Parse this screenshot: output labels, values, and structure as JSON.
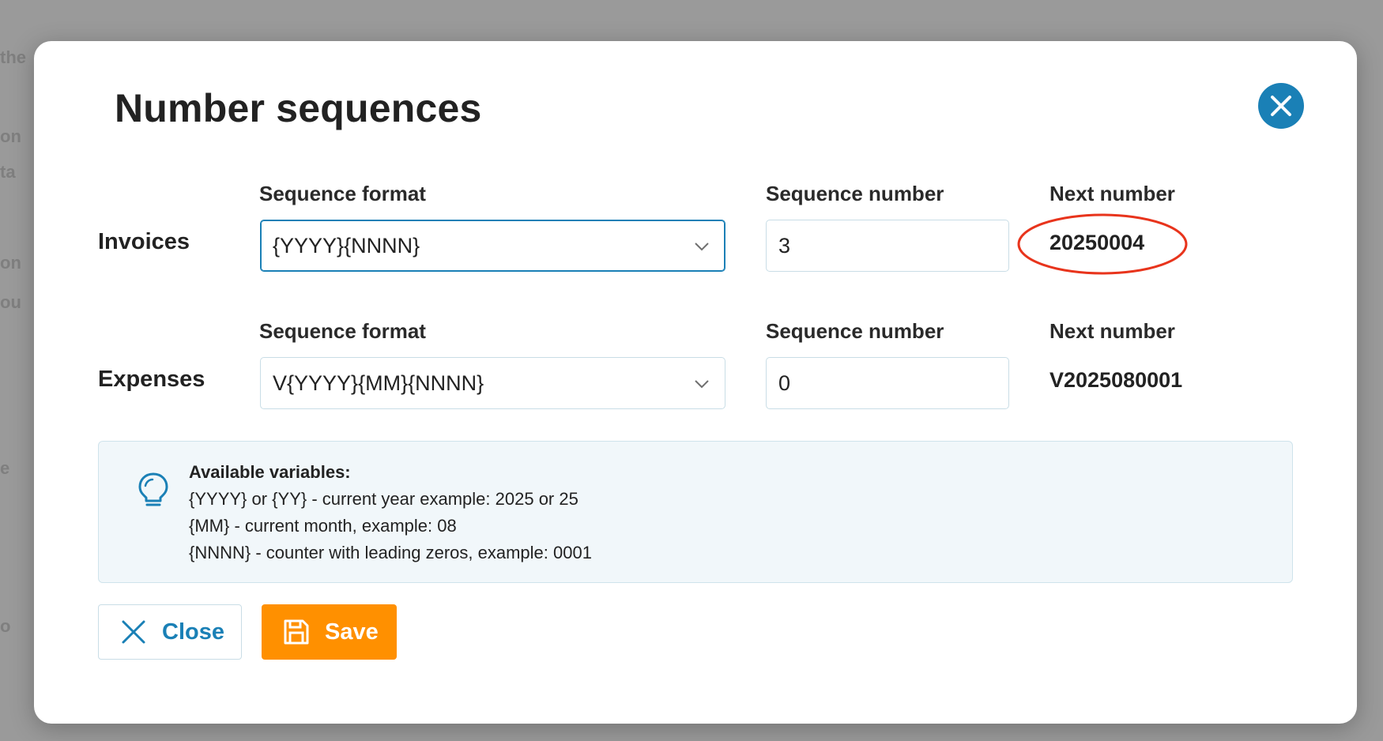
{
  "dialog": {
    "title": "Number sequences",
    "close_icon": "close-circle-icon"
  },
  "columns": {
    "format": "Sequence format",
    "number": "Sequence number",
    "next": "Next number"
  },
  "rows": [
    {
      "label": "Invoices",
      "format": "{YYYY}{NNNN}",
      "sequence_number": "3",
      "next_number": "20250004",
      "format_focused": true,
      "highlighted": true
    },
    {
      "label": "Expenses",
      "format": "V{YYYY}{MM}{NNNN}",
      "sequence_number": "0",
      "next_number": "V2025080001",
      "format_focused": false,
      "highlighted": false
    }
  ],
  "info": {
    "icon": "lightbulb-icon",
    "title": "Available variables:",
    "lines": [
      "{YYYY} or {YY} - current year example: 2025 or 25",
      "{MM} - current month, example: 08",
      "{NNNN} - counter with leading zeros, example: 0001"
    ]
  },
  "buttons": {
    "close_label": "Close",
    "save_label": "Save"
  },
  "colors": {
    "accent": "#1a80b6",
    "save": "#ff9000",
    "annotation": "#e8341c",
    "info_bg": "#f1f7fa"
  }
}
